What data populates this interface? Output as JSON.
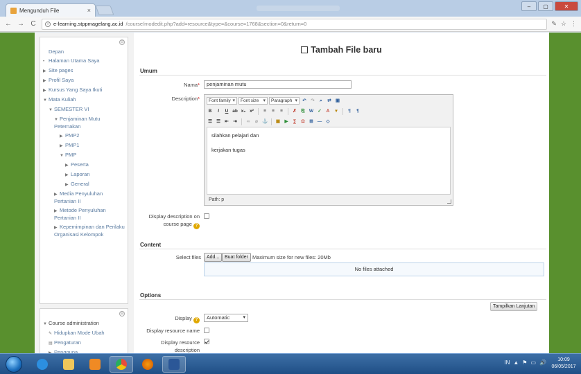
{
  "browser": {
    "tab_title": "Mengunduh File",
    "tab_close": "×",
    "window_controls": [
      "–",
      "▢",
      "✕"
    ],
    "nav": {
      "back": "←",
      "forward": "→",
      "reload": "C"
    },
    "url_host": "e-learning.stppmagelang.ac.id",
    "url_path": "/course/modedit.php?add=resource&type=&course=1768&section=0&return=0",
    "ext_buttons": [
      "✎",
      "☆",
      "⋮"
    ]
  },
  "sidebar": {
    "collapse_glyph": "⊟",
    "nav_items": [
      {
        "label": "Depan",
        "bullet": "",
        "indent": 0,
        "dark": false
      },
      {
        "label": "Halaman Utama Saya",
        "bullet": "•",
        "indent": 0,
        "dark": false
      },
      {
        "label": "Site pages",
        "bullet": "▶",
        "indent": 0,
        "dark": false
      },
      {
        "label": "Profil Saya",
        "bullet": "▶",
        "indent": 0,
        "dark": false
      },
      {
        "label": "Kursus Yang Saya Ikuti",
        "bullet": "▶",
        "indent": 0,
        "dark": false
      },
      {
        "label": "Mata Kuliah",
        "bullet": "▼",
        "indent": 0,
        "dark": false
      },
      {
        "label": "SEMESTER VI",
        "bullet": "▼",
        "indent": 1,
        "dark": false
      },
      {
        "label": "Penjaminan Mutu Peternakan",
        "bullet": "▼",
        "indent": 2,
        "dark": false
      },
      {
        "label": "PMP2",
        "bullet": "▶",
        "indent": 3,
        "dark": false
      },
      {
        "label": "PMP1",
        "bullet": "▶",
        "indent": 3,
        "dark": false
      },
      {
        "label": "PMP",
        "bullet": "▼",
        "indent": 3,
        "dark": false
      },
      {
        "label": "Peserta",
        "bullet": "▶",
        "indent": 4,
        "dark": false
      },
      {
        "label": "Laporan",
        "bullet": "▶",
        "indent": 4,
        "dark": false
      },
      {
        "label": "General",
        "bullet": "▶",
        "indent": 4,
        "dark": false
      },
      {
        "label": "Media Penyuluhan Pertanian II",
        "bullet": "▶",
        "indent": 2,
        "dark": false
      },
      {
        "label": "Metode Penyuluhan Pertanian II",
        "bullet": "▶",
        "indent": 2,
        "dark": false
      },
      {
        "label": "Kepemimpinan dan Perilaku Organisasi Kelompok",
        "bullet": "▶",
        "indent": 2,
        "dark": false
      }
    ],
    "admin_items": [
      {
        "label": "Course administration",
        "bullet": "▼",
        "indent": 0,
        "dark": true
      },
      {
        "label": "Hidupkan Mode Ubah",
        "bullet": "✎",
        "indent": 1,
        "dark": false
      },
      {
        "label": "Pengaturan",
        "bullet": "▤",
        "indent": 1,
        "dark": false
      },
      {
        "label": "Pengguna",
        "bullet": "▶",
        "indent": 1,
        "dark": false
      }
    ]
  },
  "main": {
    "title": "Tambah File baru",
    "sections": {
      "general": "Umum",
      "content": "Content",
      "options": "Options"
    },
    "fields": {
      "name_label": "Nama",
      "name_value": "penjaminan mutu",
      "description_label": "Description",
      "required_mark": "*",
      "display_desc_label_1": "Display description on",
      "display_desc_label_2": "course page",
      "help_glyph": "?",
      "select_files_label": "Select files",
      "add_button": "Add...",
      "create_folder_button": "Buat folder",
      "max_size_text": "Maximum size for new files: 20Mb",
      "no_files": "No files attached",
      "show_more": "Tampilkan Lanjutan",
      "display_label": "Display",
      "display_value": "Automatic",
      "display_resource_name_label": "Display resource name",
      "display_resource_desc_label_1": "Display resource",
      "display_resource_desc_label_2": "description"
    },
    "editor": {
      "font_family": "Font family",
      "font_size": "Font size",
      "paragraph": "Paragraph",
      "content_lines": [
        "silahkan pelajari dan",
        "kerjakan tugas"
      ],
      "path": "Path: p"
    }
  },
  "taskbar": {
    "tray": [
      "IN",
      "▲",
      "⚑",
      "▭",
      "🔊"
    ],
    "time": "10:09",
    "date": "06/05/2017"
  },
  "colors": {
    "page_green": "#59902e",
    "link_blue": "#5a7ba0",
    "taskbar_blue": "#2a5d95"
  }
}
